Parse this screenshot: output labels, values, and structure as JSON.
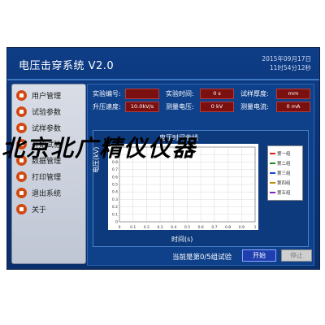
{
  "app": {
    "title": "电压击穿系统  V2.0",
    "date": "2015年09月17日",
    "time": "11时54分12秒"
  },
  "sidebar": {
    "items": [
      {
        "label": "用户管理",
        "icon": "orange-gear-icon"
      },
      {
        "label": "试验参数",
        "icon": "orange-gear-icon"
      },
      {
        "label": "试样参数",
        "icon": "orange-gear-icon"
      },
      {
        "label": "开始试验",
        "icon": "orange-gear-icon"
      },
      {
        "label": "数据管理",
        "icon": "orange-gear-icon"
      },
      {
        "label": "打印管理",
        "icon": "orange-gear-icon"
      },
      {
        "label": "退出系统",
        "icon": "orange-gear-icon"
      },
      {
        "label": "关于",
        "icon": "orange-gear-icon"
      }
    ]
  },
  "params": {
    "exp_no_label": "实验编号:",
    "exp_no_value": "",
    "exp_time_label": "实验时间:",
    "exp_time_value": "0 s",
    "thickness_label": "试样厚度:",
    "thickness_value": "mm",
    "boost_label": "升压速度:",
    "boost_value": "10.0kV/s",
    "voltage_label": "测量电压:",
    "voltage_value": "0 kV",
    "current_label": "测量电流:",
    "current_value": "0 mA"
  },
  "chart": {
    "title": "电压时间曲线",
    "ylabel": "电压(kV)",
    "xlabel": "时间(s)",
    "legend": [
      "第一组",
      "第二组",
      "第三组",
      "第四组",
      "第五组"
    ],
    "colors": [
      "#e11d1d",
      "#1d8f1d",
      "#1d3fe1",
      "#c08a00",
      "#8a1dc0"
    ]
  },
  "chart_data": {
    "type": "line",
    "title": "电压时间曲线",
    "xlabel": "时间(s)",
    "ylabel": "电压(kV)",
    "x_ticks": [
      "0",
      "0.1",
      "0.2",
      "0.3",
      "0.4",
      "0.5",
      "0.6",
      "0.7",
      "0.8",
      "0.9",
      "1"
    ],
    "y_ticks": [
      "0",
      "0.1",
      "0.2",
      "0.3",
      "0.4",
      "0.5",
      "0.6",
      "0.7",
      "0.8",
      "0.9",
      "1"
    ],
    "xlim": [
      0,
      1
    ],
    "ylim": [
      0,
      1
    ],
    "series": [
      {
        "name": "第一组",
        "values": []
      },
      {
        "name": "第二组",
        "values": []
      },
      {
        "name": "第三组",
        "values": []
      },
      {
        "name": "第四组",
        "values": []
      },
      {
        "name": "第五组",
        "values": []
      }
    ],
    "grid": true,
    "legend_position": "right"
  },
  "footer": {
    "status": "当前是第0/5组试验",
    "start_label": "开始",
    "stop_label": "停止"
  },
  "watermark": "北京北广精仪仪器"
}
